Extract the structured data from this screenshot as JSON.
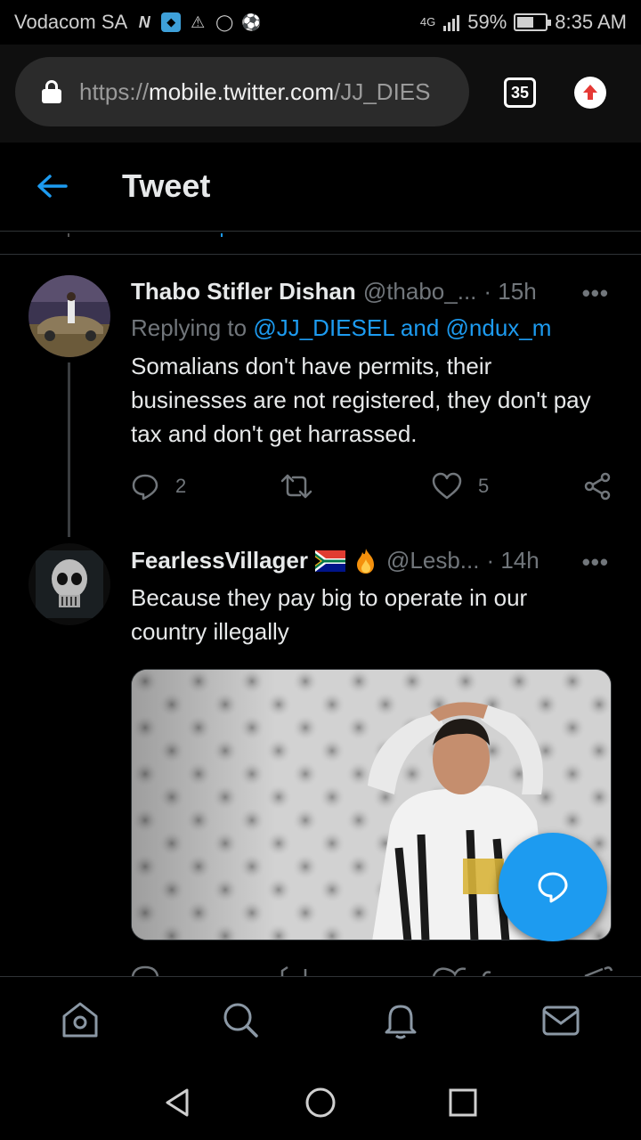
{
  "status_bar": {
    "carrier": "Vodacom SA",
    "network": "4G",
    "battery": "59%",
    "battery_level": 0.59,
    "time": "8:35 AM"
  },
  "browser": {
    "url_scheme": "https://",
    "url_host": "mobile.twitter.com",
    "url_path": "/JJ_DIES",
    "tab_count": "35"
  },
  "header": {
    "title": "Tweet"
  },
  "tweets": [
    {
      "name": "Thabo Stifler Dishan",
      "handle": "@thabo_...",
      "time": "· 15h",
      "replying_prefix": "Replying to ",
      "replying_to": "@JJ_DIESEL and @ndux_m",
      "text": "Somalians don't have permits, their businesses are not registered, they don't pay tax and don't get harrassed.",
      "replies": "2",
      "retweets": "",
      "likes": "5"
    },
    {
      "name": "FearlessVillager",
      "handle": "@Lesb...",
      "time": "· 14h",
      "text": "Because they pay big to operate in our country illegally"
    }
  ],
  "icons": {
    "back": "arrow-left-icon",
    "more": "more-icon",
    "reply": "reply-icon",
    "retweet": "retweet-icon",
    "like": "heart-icon",
    "share": "share-icon",
    "compose": "compose-icon"
  },
  "more_label": "•••",
  "colors": {
    "accent": "#1d9bf0",
    "background": "#000000",
    "muted": "#71767b"
  }
}
